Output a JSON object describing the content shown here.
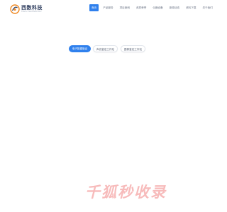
{
  "header": {
    "logo_name": "西数科技",
    "logo_subtitle": "XISHU TECHNOLOGY",
    "nav": [
      {
        "label": "首页",
        "active": true
      },
      {
        "label": "产品服务",
        "active": false
      },
      {
        "label": "项目案例",
        "active": false
      },
      {
        "label": "资质荣誉",
        "active": false
      },
      {
        "label": "仪器设备",
        "active": false
      },
      {
        "label": "新闻动态",
        "active": false
      },
      {
        "label": "资料下载",
        "active": false
      },
      {
        "label": "关于我们",
        "active": false
      }
    ]
  },
  "main": {
    "buttons": [
      {
        "label": "电子数据取证"
      },
      {
        "label": "声纹鉴定工作站"
      },
      {
        "label": "图像鉴定工作站"
      }
    ]
  },
  "watermark": {
    "text": "千狐秒收录"
  },
  "colors": {
    "accent": "#2f80ed",
    "logo_orange": "#f08a24",
    "logo_navy": "#2b3a5c",
    "watermark": "#ef6a6a"
  }
}
